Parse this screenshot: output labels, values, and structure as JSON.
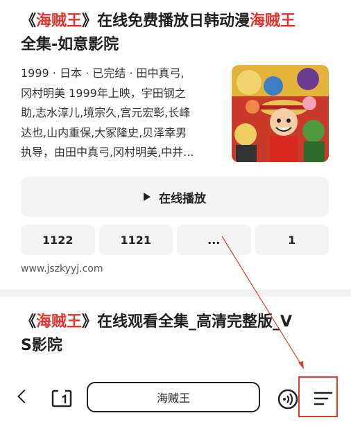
{
  "result1": {
    "title_pre": "《",
    "title_hl1": "海贼王",
    "title_mid": "》在线免费播放日韩动漫",
    "title_hl2": "海贼王",
    "title_line2": "全集-如意影院",
    "desc_lines": [
      "1999 · 日本 · 已完结 · 田中真弓,",
      "冈村明美 1999年上映，宇田钢之",
      "助,志水淳儿,境宗久,宫元宏彰,长峰",
      "达也,山内重保,大冢隆史,贝泽幸男",
      "执导，由田中真弓,冈村明美,中井..."
    ],
    "play_label": "在线播放",
    "episodes": [
      "1122",
      "1121",
      "...",
      "1"
    ],
    "url": "www.jszkyyj.com"
  },
  "result2": {
    "title_pre": "《",
    "title_hl": "海贼王",
    "title_rest": "》在线观看全集_高清完整版_V",
    "title_line2": "S影院"
  },
  "bottom_bar": {
    "search_text": "海贼王",
    "icons": [
      "back-icon",
      "tabs-icon",
      "listen-icon",
      "menu-icon"
    ]
  },
  "colors": {
    "highlight": "#e5312b",
    "annotation": "#e23b31"
  }
}
